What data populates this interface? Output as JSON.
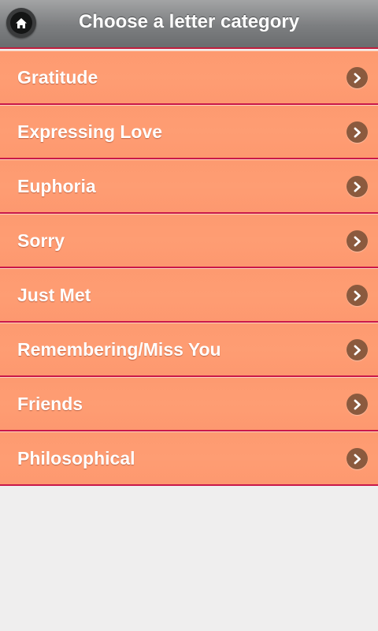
{
  "header": {
    "title": "Choose a letter category",
    "home_icon": "home-icon"
  },
  "categories": [
    {
      "label": "Gratitude"
    },
    {
      "label": "Expressing Love"
    },
    {
      "label": "Euphoria"
    },
    {
      "label": "Sorry"
    },
    {
      "label": "Just Met"
    },
    {
      "label": "Remembering/Miss You"
    },
    {
      "label": "Friends"
    },
    {
      "label": "Philosophical"
    }
  ],
  "colors": {
    "item_background": "#fd9a70",
    "item_divider": "#c9184a",
    "chevron_background": "#8b5a3e",
    "header_background": "#7c7e80",
    "page_background": "#efeeee"
  }
}
